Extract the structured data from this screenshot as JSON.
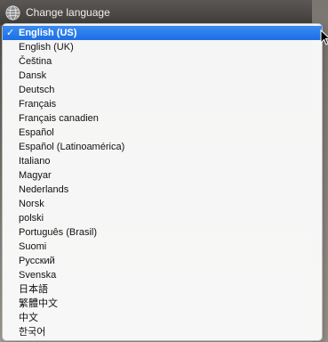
{
  "header": {
    "change_language_label": "Change language"
  },
  "menu": {
    "selected_index": 0,
    "checkmark": "✓",
    "items": [
      "English (US)",
      "English (UK)",
      "Čeština",
      "Dansk",
      "Deutsch",
      "Français",
      "Français canadien",
      "Español",
      "Español (Latinoamérica)",
      "Italiano",
      "Magyar",
      "Nederlands",
      "Norsk",
      "polski",
      "Português (Brasil)",
      "Suomi",
      "Русский",
      "Svenska",
      "日本語",
      "繁體中文",
      "中文",
      "한국어"
    ]
  },
  "colors": {
    "highlight": "#1e6ee6"
  }
}
